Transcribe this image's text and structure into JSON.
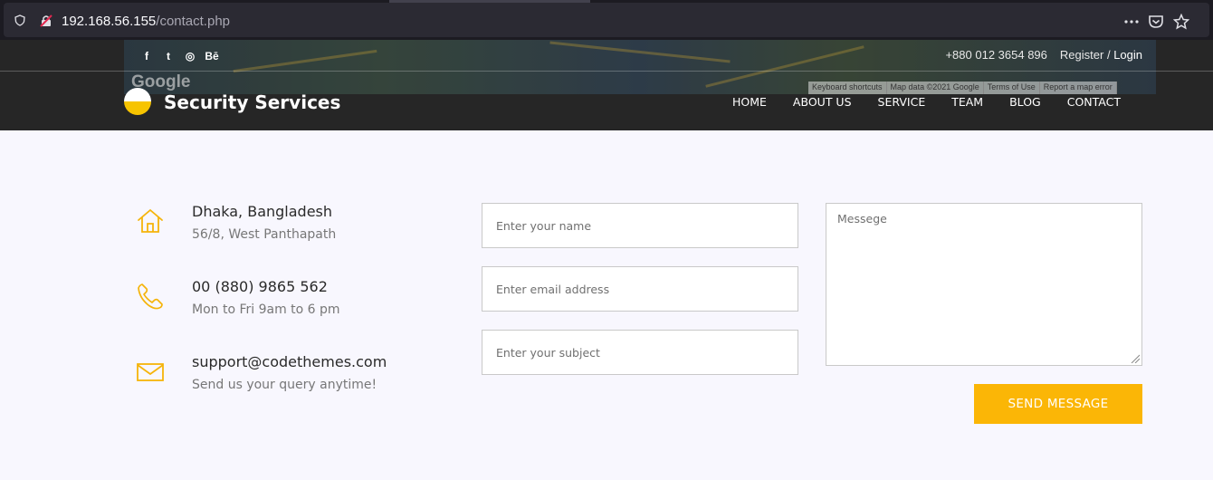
{
  "browser": {
    "url_host": "192.168.56.155",
    "url_path": "/contact.php"
  },
  "map": {
    "google_label": "Google",
    "footer": [
      "Keyboard shortcuts",
      "Map data ©2021 Google",
      "Terms of Use",
      "Report a map error"
    ]
  },
  "topbar": {
    "social": [
      "f",
      "t",
      "◎",
      "Bē"
    ],
    "phone": "+880 012 3654 896",
    "register": "Register",
    "separator": "/",
    "login": "Login"
  },
  "header": {
    "brand": "Security Services",
    "nav": [
      "HOME",
      "ABOUT US",
      "SERVICE",
      "TEAM",
      "BLOG",
      "CONTACT"
    ]
  },
  "contact_info": [
    {
      "icon": "home-icon",
      "title": "Dhaka, Bangladesh",
      "sub": "56/8, West Panthapath"
    },
    {
      "icon": "phone-icon",
      "title": "00 (880) 9865 562",
      "sub": "Mon to Fri 9am to 6 pm"
    },
    {
      "icon": "mail-icon",
      "title": "support@codethemes.com",
      "sub": "Send us your query anytime!"
    }
  ],
  "form": {
    "name_placeholder": "Enter your name",
    "email_placeholder": "Enter email address",
    "subject_placeholder": "Enter your subject",
    "message_placeholder": "Messege",
    "send_label": "SEND MESSAGE"
  },
  "colors": {
    "accent": "#fbb606",
    "header_bg": "#262626",
    "page_bg": "#f8f7fe"
  }
}
